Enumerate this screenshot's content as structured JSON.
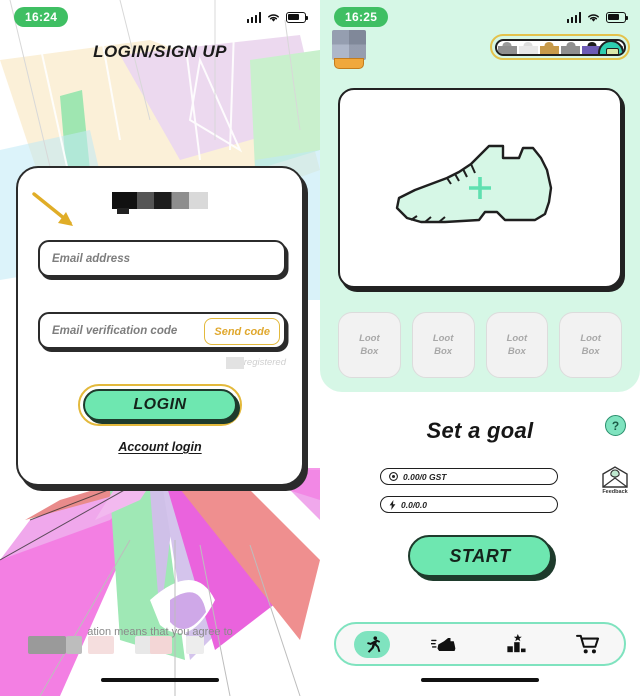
{
  "left": {
    "status": {
      "time": "16:24",
      "signal_icon": "signal-bars-icon",
      "wifi_icon": "wifi-icon",
      "battery_icon": "battery-icon"
    },
    "title": "LOGIN/SIGN UP",
    "annotation_arrow": "arrow-annotation-icon",
    "form": {
      "email_placeholder": "Email address",
      "code_placeholder": "Email verification code",
      "send_code_label": "Send code",
      "registered_note": "registered",
      "login_label": "LOGIN",
      "account_login_label": "Account login"
    },
    "footer_text": "ation means that you agree to"
  },
  "right": {
    "status": {
      "time": "16:25",
      "signal_icon": "signal-bars-icon",
      "wifi_icon": "wifi-icon",
      "battery_icon": "battery-icon"
    },
    "shoe_card": {
      "shoe_icon": "sneaker-outline-icon",
      "plus_icon": "plus-icon"
    },
    "loot_boxes": [
      {
        "line1": "Loot",
        "line2": "Box"
      },
      {
        "line1": "Loot",
        "line2": "Box"
      },
      {
        "line1": "Loot",
        "line2": "Box"
      },
      {
        "line1": "Loot",
        "line2": "Box"
      }
    ],
    "goal": {
      "title": "Set a goal",
      "help_label": "?",
      "feedback_label": "Feedback",
      "gst_value": "0.00/0 GST",
      "gst_icon": "coin-icon",
      "energy_value": "0.0/0.0",
      "energy_icon": "energy-bolt-icon",
      "start_label": "START"
    },
    "tabs": [
      {
        "icon": "runner-icon",
        "active": true
      },
      {
        "icon": "sneaker-icon",
        "active": false
      },
      {
        "icon": "leaderboard-icon",
        "active": false
      },
      {
        "icon": "cart-icon",
        "active": false
      }
    ]
  },
  "colors": {
    "mint": "#d6f7e6",
    "accent_green": "#6ee7b0",
    "accent_green_light": "#7fe3bf",
    "gold": "#e3b93c",
    "status_green": "#3fbf63",
    "ink": "#1f1f1f"
  }
}
